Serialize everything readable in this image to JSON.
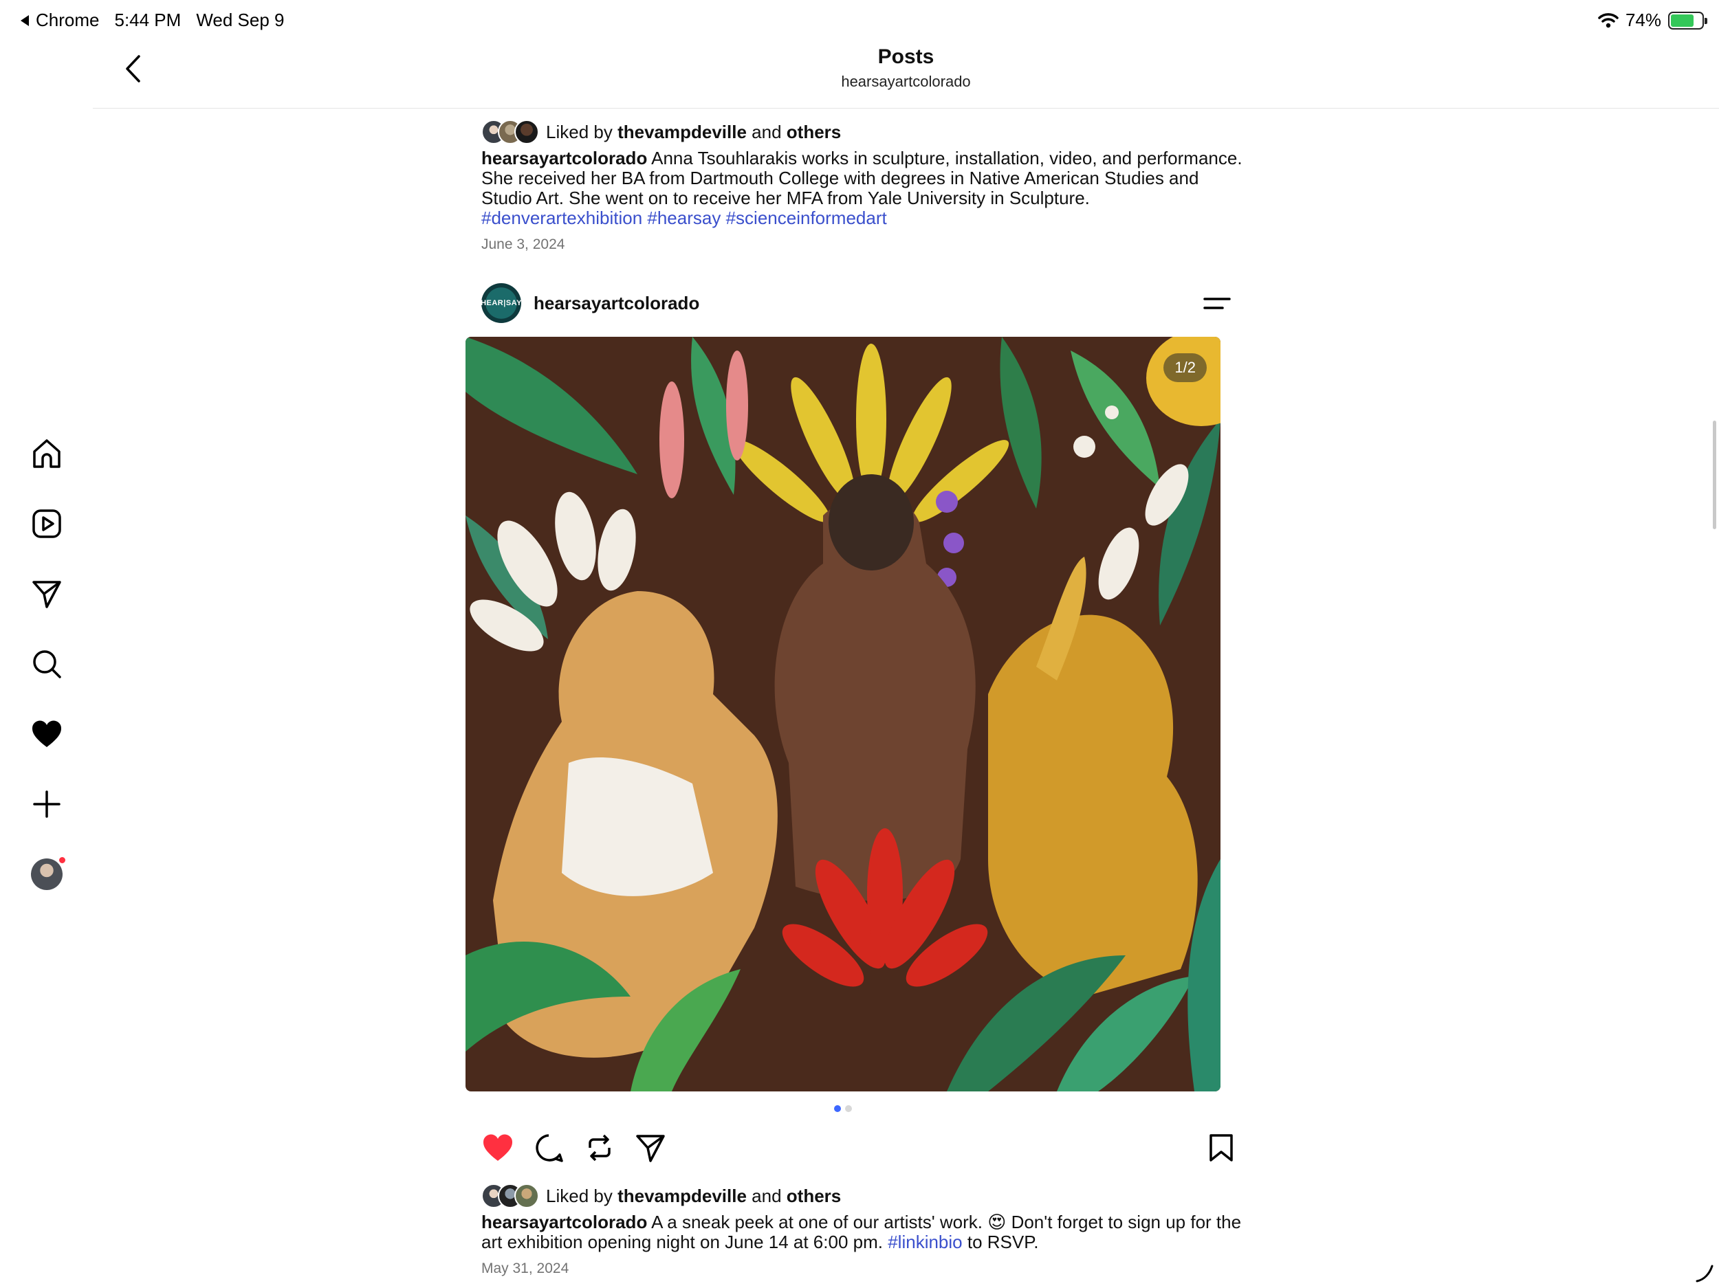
{
  "status_bar": {
    "back_app": "Chrome",
    "time": "5:44 PM",
    "date": "Wed Sep 9",
    "battery": "74%",
    "battery_level": 0.74
  },
  "header": {
    "title": "Posts",
    "subtitle": "hearsayartcolorado"
  },
  "nav": {
    "items": [
      "home-icon",
      "reels-icon",
      "messages-icon",
      "search-icon",
      "notifications-icon",
      "create-icon",
      "profile-avatar"
    ]
  },
  "posts": [
    {
      "likes": {
        "prefix": "Liked by",
        "user": "thevampdeville",
        "joiner": "and",
        "others": "others"
      },
      "caption": {
        "user": "hearsayartcolorado",
        "text": "Anna Tsouhlarakis works in sculpture, installation, video, and performance. She received her BA from Dartmouth College with degrees in Native American Studies and Studio Art. She went on to receive her MFA from Yale University in Sculpture.",
        "tags": [
          "#denverartexhibition",
          "#hearsay",
          "#scienceinformedart"
        ]
      },
      "date": "June 3, 2024"
    },
    {
      "user": "hearsayartcolorado",
      "avatar_text": "HEAR|SAY",
      "media_counter": "1/2",
      "carousel": {
        "count": 2,
        "active": 1
      },
      "liked": true,
      "likes": {
        "prefix": "Liked by",
        "user": "thevampdeville",
        "joiner": "and",
        "others": "others"
      },
      "caption": {
        "user": "hearsayartcolorado",
        "text_before": "A a sneak peek at one of our artists' work. 😍 Don't forget to sign up for the art exhibition opening night on June 14 at 6:00 pm.",
        "tag": "#linkinbio",
        "text_after": "to RSVP."
      },
      "date": "May 31, 2024"
    }
  ],
  "colors": {
    "like_red": "#ff3040",
    "hashtag_blue": "#3a4fcc",
    "carousel_active": "#3d67ff"
  }
}
